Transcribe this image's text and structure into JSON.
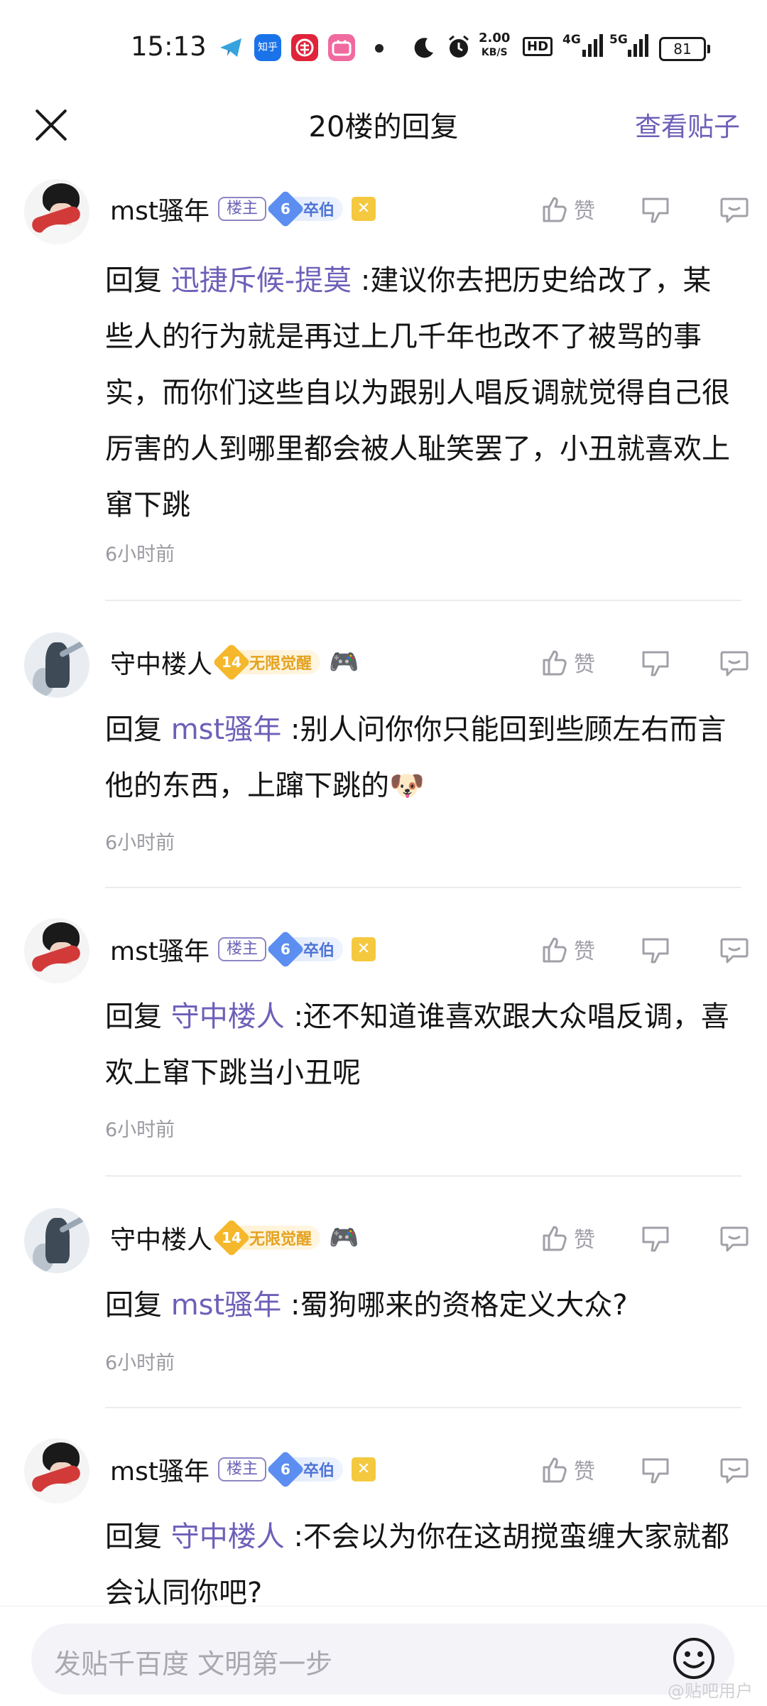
{
  "status_bar": {
    "time": "15:13",
    "app_icons": [
      "telegram-icon",
      "zhihu-icon",
      "app-red-icon",
      "bilibili-icon"
    ],
    "zhihu_text": "知乎",
    "speed_value": "2.00",
    "speed_unit": "KB/S",
    "hd_label": "HD",
    "net1": "4G",
    "net2": "5G",
    "battery": "81"
  },
  "header": {
    "title": "20楼的回复",
    "view_post": "查看贴子"
  },
  "labels": {
    "reply_prefix": "回复",
    "like": "赞",
    "lz_tag": "楼主",
    "mst_level": "6",
    "mst_level_title": "卒伯",
    "sz_level": "14",
    "sz_level_title": "无限觉醒"
  },
  "replies": [
    {
      "user": "mst骚年",
      "to": "迅捷斥候-提莫",
      "text": ":建议你去把历史给改了，某些人的行为就是再过上几千年也改不了被骂的事实，而你们这些自以为跟别人唱反调就觉得自己很厉害的人到哪里都会被人耻笑罢了，小丑就喜欢上窜下跳",
      "time": "6小时前"
    },
    {
      "user": "守中楼人",
      "to": "mst骚年",
      "text": ":别人问你你只能回到些顾左右而言他的东西，上蹿下跳的🐶",
      "time": "6小时前"
    },
    {
      "user": "mst骚年",
      "to": "守中楼人",
      "text": ":还不知道谁喜欢跟大众唱反调，喜欢上窜下跳当小丑呢",
      "time": "6小时前"
    },
    {
      "user": "守中楼人",
      "to": "mst骚年",
      "text": ":蜀狗哪来的资格定义大众?",
      "time": "6小时前"
    },
    {
      "user": "mst骚年",
      "to": "守中楼人",
      "text": ":不会以为你在这胡搅蛮缠大家就都会认同你吧?",
      "time": ""
    }
  ],
  "input": {
    "placeholder": "发贴千百度 文明第一步"
  },
  "watermark": "@贴吧用户"
}
